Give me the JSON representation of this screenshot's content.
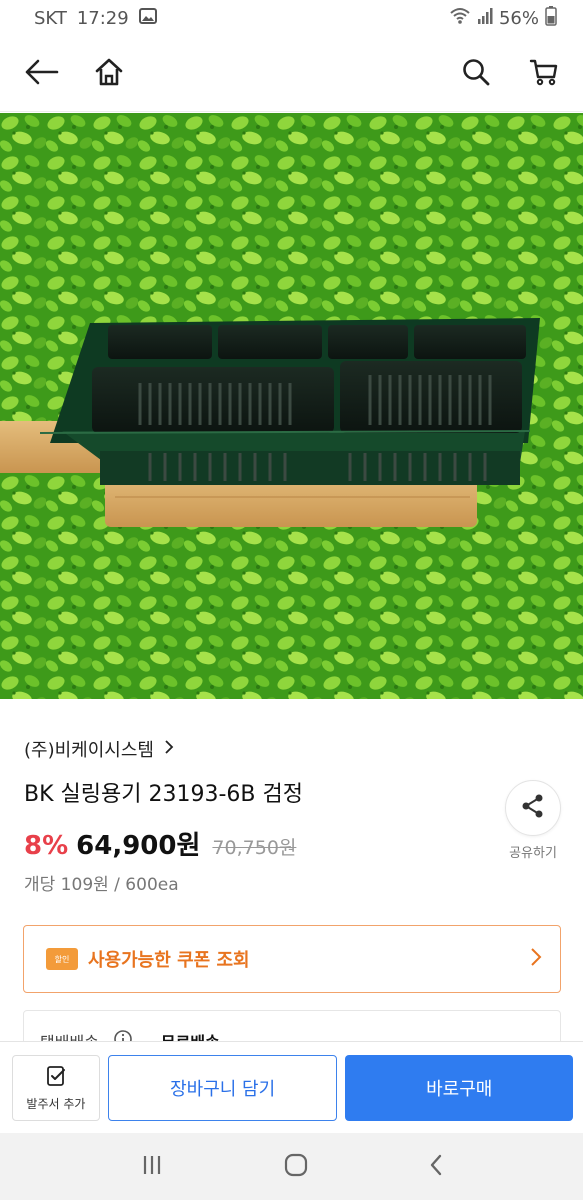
{
  "status_bar": {
    "carrier": "SKT",
    "time": "17:29",
    "battery": "56%"
  },
  "nav": {
    "back_icon": "arrow-left-icon",
    "home_icon": "home-icon",
    "search_icon": "search-icon",
    "cart_icon": "cart-icon"
  },
  "product": {
    "seller": "(주)비케이시스템",
    "name": "BK 실링용기 23193-6B 검정",
    "discount": "8%",
    "price": "64,900원",
    "original_price": "70,750원",
    "unit_price": "개당 109원 / 600ea",
    "share_label": "공유하기"
  },
  "coupon": {
    "badge": "할인",
    "text": "사용가능한 쿠폰 조회"
  },
  "shipping": {
    "label": "택배배송",
    "value": "무료배송"
  },
  "actions": {
    "order_sheet": "발주서 추가",
    "cart": "장바구니 담기",
    "buy": "바로구매"
  },
  "colors": {
    "discount": "#e8404a",
    "coupon": "#e8741f",
    "primary": "#2f7cf0"
  }
}
